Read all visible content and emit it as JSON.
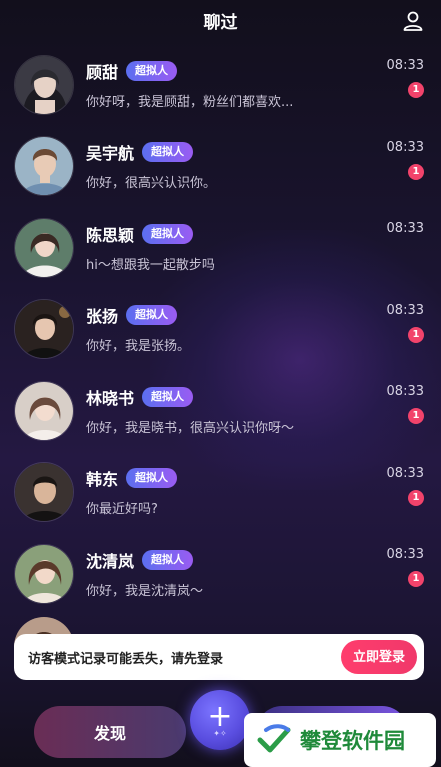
{
  "header": {
    "title": "聊过"
  },
  "conversations": [
    {
      "name": "顾甜",
      "badge": "超拟人",
      "message": "你好呀，我是顾甜，粉丝们都喜欢...",
      "time": "08:33",
      "unread": "1"
    },
    {
      "name": "吴宇航",
      "badge": "超拟人",
      "message": "你好，很高兴认识你。",
      "time": "08:33",
      "unread": "1"
    },
    {
      "name": "陈思颖",
      "badge": "超拟人",
      "message": "hi～想跟我一起散步吗",
      "time": "08:33",
      "unread": ""
    },
    {
      "name": "张扬",
      "badge": "超拟人",
      "message": "你好，我是张扬。",
      "time": "08:33",
      "unread": "1"
    },
    {
      "name": "林晓书",
      "badge": "超拟人",
      "message": "你好，我是晓书，很高兴认识你呀～",
      "time": "08:33",
      "unread": "1"
    },
    {
      "name": "韩东",
      "badge": "超拟人",
      "message": "你最近好吗?",
      "time": "08:33",
      "unread": "1"
    },
    {
      "name": "沈清岚",
      "badge": "超拟人",
      "message": "你好，我是沈清岚～",
      "time": "08:33",
      "unread": "1"
    }
  ],
  "toast": {
    "text": "访客模式记录可能丢失，请先登录",
    "login_label": "立即登录"
  },
  "tabbar": {
    "discover_label": "发现",
    "add_icon": "plus-icon"
  },
  "watermark": {
    "text": "攀登软件园"
  },
  "colors": {
    "badge": "#7b63f0",
    "unread": "#f2436b",
    "login": "#ff3d6d",
    "background": "#1a1430"
  }
}
